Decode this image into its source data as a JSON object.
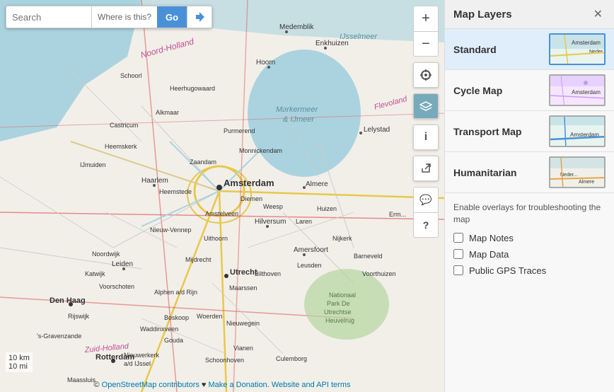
{
  "search": {
    "placeholder": "Search",
    "where_is_this": "Where is this?",
    "go_label": "Go"
  },
  "map_controls": {
    "zoom_in": "+",
    "zoom_out": "−",
    "locate": "⊕",
    "layers": "◉",
    "info": "ℹ",
    "share": "⤴",
    "comment": "💬",
    "help": "?"
  },
  "attribution": {
    "prefix": "© ",
    "osm_link_text": "OpenStreetMap contributors",
    "separator": " ♥ ",
    "donate_text": "Make a Donation",
    "api_text": "Website and API terms"
  },
  "scale": {
    "metric": "10 km",
    "imperial": "10 mi"
  },
  "panel": {
    "title": "Map Layers",
    "close_icon": "✕",
    "layers": [
      {
        "id": "standard",
        "label": "Standard",
        "active": true
      },
      {
        "id": "cycle",
        "label": "Cycle Map",
        "active": false
      },
      {
        "id": "transport",
        "label": "Transport Map",
        "active": false
      },
      {
        "id": "humanitarian",
        "label": "Humanitarian",
        "active": false
      }
    ],
    "overlays_title": "Enable overlays for troubleshooting the map",
    "overlays": [
      {
        "id": "map-notes",
        "label": "Map Notes",
        "checked": false
      },
      {
        "id": "map-data",
        "label": "Map Data",
        "checked": false
      },
      {
        "id": "public-gps",
        "label": "Public GPS Traces",
        "checked": false
      }
    ]
  }
}
